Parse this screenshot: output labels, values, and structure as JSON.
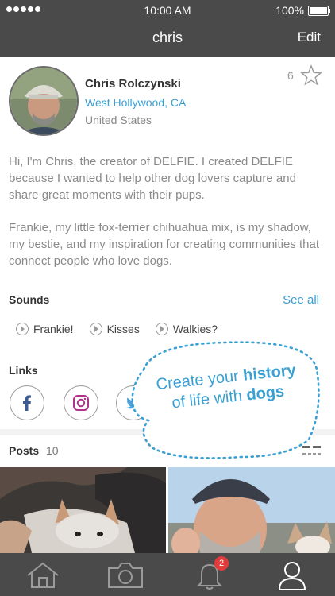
{
  "status_bar": {
    "time": "10:00 AM",
    "battery": "100%"
  },
  "nav": {
    "title": "chris",
    "edit_label": "Edit"
  },
  "profile": {
    "name": "Chris Rolczynski",
    "city": "West Hollywood, CA",
    "country": "United States",
    "star_count": "6"
  },
  "bio": {
    "paragraph1": "Hi, I'm Chris, the creator of DELFIE. I created DELFIE because I wanted to help other dog lovers capture and share great moments with their pups.",
    "paragraph2": "Frankie, my little fox-terrier chihuahua mix, is my shadow, my bestie, and my inspiration for creating communities that connect people who love dogs."
  },
  "sounds": {
    "title": "Sounds",
    "see_all": "See all",
    "items": [
      {
        "label": "Frankie!"
      },
      {
        "label": "Kisses"
      },
      {
        "label": "Walkies?"
      }
    ]
  },
  "links": {
    "title": "Links",
    "items": [
      "facebook-icon",
      "instagram-icon",
      "twitter-icon"
    ]
  },
  "posts": {
    "title": "Posts",
    "count": "10"
  },
  "promo": {
    "line1_pre": "Create your ",
    "line1_bold": "history",
    "line2_pre": "of life with ",
    "line2_bold": "dogs"
  },
  "tabbar": {
    "notification_count": "2"
  },
  "colors": {
    "accent": "#3a9fd3",
    "bar": "#4a4a4a",
    "badge": "#e23b3b"
  }
}
